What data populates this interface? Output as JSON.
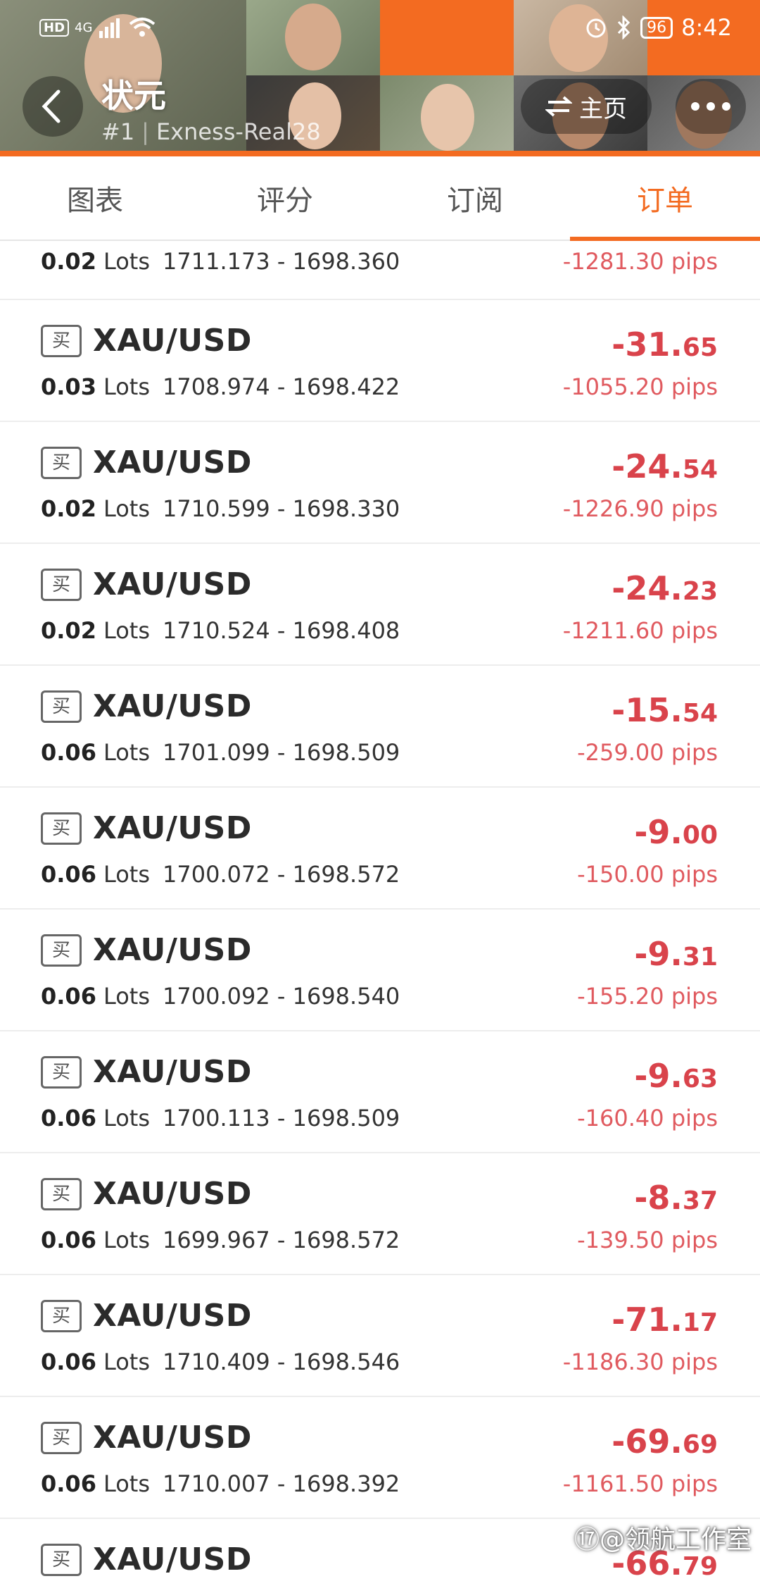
{
  "status_bar": {
    "network_left": "HD",
    "signal": "4G",
    "battery": "96",
    "time": "8:42"
  },
  "header": {
    "title": "状元",
    "rank": "#1",
    "account": "Exness-Real28",
    "home_label": "主页",
    "accent_color": "#f36b21"
  },
  "tabs": [
    {
      "label": "图表",
      "active": false
    },
    {
      "label": "评分",
      "active": false
    },
    {
      "label": "订阅",
      "active": false
    },
    {
      "label": "订单",
      "active": true
    }
  ],
  "partial_order": {
    "lots": "0.02",
    "lots_unit": "Lots",
    "prices": "1711.173 - 1698.360",
    "pips": "-1281.30 pips"
  },
  "orders": [
    {
      "side": "买",
      "symbol": "XAU/USD",
      "lots": "0.03",
      "lots_unit": "Lots",
      "prices": "1708.974 - 1698.422",
      "profit_int": "-31.",
      "profit_dec": "65",
      "pips": "-1055.20 pips"
    },
    {
      "side": "买",
      "symbol": "XAU/USD",
      "lots": "0.02",
      "lots_unit": "Lots",
      "prices": "1710.599 - 1698.330",
      "profit_int": "-24.",
      "profit_dec": "54",
      "pips": "-1226.90 pips"
    },
    {
      "side": "买",
      "symbol": "XAU/USD",
      "lots": "0.02",
      "lots_unit": "Lots",
      "prices": "1710.524 - 1698.408",
      "profit_int": "-24.",
      "profit_dec": "23",
      "pips": "-1211.60 pips"
    },
    {
      "side": "买",
      "symbol": "XAU/USD",
      "lots": "0.06",
      "lots_unit": "Lots",
      "prices": "1701.099 - 1698.509",
      "profit_int": "-15.",
      "profit_dec": "54",
      "pips": "-259.00 pips"
    },
    {
      "side": "买",
      "symbol": "XAU/USD",
      "lots": "0.06",
      "lots_unit": "Lots",
      "prices": "1700.072 - 1698.572",
      "profit_int": "-9.",
      "profit_dec": "00",
      "pips": "-150.00 pips"
    },
    {
      "side": "买",
      "symbol": "XAU/USD",
      "lots": "0.06",
      "lots_unit": "Lots",
      "prices": "1700.092 - 1698.540",
      "profit_int": "-9.",
      "profit_dec": "31",
      "pips": "-155.20 pips"
    },
    {
      "side": "买",
      "symbol": "XAU/USD",
      "lots": "0.06",
      "lots_unit": "Lots",
      "prices": "1700.113 - 1698.509",
      "profit_int": "-9.",
      "profit_dec": "63",
      "pips": "-160.40 pips"
    },
    {
      "side": "买",
      "symbol": "XAU/USD",
      "lots": "0.06",
      "lots_unit": "Lots",
      "prices": "1699.967 - 1698.572",
      "profit_int": "-8.",
      "profit_dec": "37",
      "pips": "-139.50 pips"
    },
    {
      "side": "买",
      "symbol": "XAU/USD",
      "lots": "0.06",
      "lots_unit": "Lots",
      "prices": "1710.409 - 1698.546",
      "profit_int": "-71.",
      "profit_dec": "17",
      "pips": "-1186.30 pips"
    },
    {
      "side": "买",
      "symbol": "XAU/USD",
      "lots": "0.06",
      "lots_unit": "Lots",
      "prices": "1710.007 - 1698.392",
      "profit_int": "-69.",
      "profit_dec": "69",
      "pips": "-1161.50 pips"
    },
    {
      "side": "买",
      "symbol": "XAU/USD",
      "lots": "",
      "lots_unit": "",
      "prices": "",
      "profit_int": "-66.",
      "profit_dec": "79",
      "pips": ""
    }
  ],
  "watermark": "⑰@领航工作室",
  "colors": {
    "loss_red": "#d9434b",
    "pips_red": "#e05a5f",
    "tab_active": "#f36b21"
  }
}
